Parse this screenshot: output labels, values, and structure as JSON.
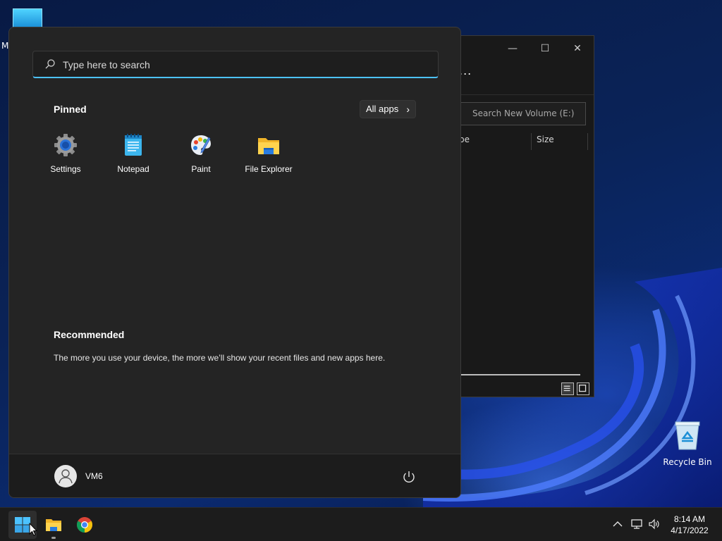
{
  "desktop": {
    "left_label": "M",
    "recycle_bin_label": "Recycle Bin"
  },
  "explorer": {
    "more_label": "...",
    "search_placeholder": "Search New Volume (E:)",
    "columns": [
      "pe",
      "Size"
    ],
    "window_buttons": {
      "minimize": "—",
      "maximize": "☐",
      "close": "✕"
    }
  },
  "start_menu": {
    "search_placeholder": "Type here to search",
    "pinned_title": "Pinned",
    "all_apps_label": "All apps",
    "all_apps_chevron": "›",
    "pinned_apps": [
      {
        "label": "Settings",
        "icon": "settings-icon"
      },
      {
        "label": "Notepad",
        "icon": "notepad-icon"
      },
      {
        "label": "Paint",
        "icon": "paint-icon"
      },
      {
        "label": "File Explorer",
        "icon": "file-explorer-icon"
      }
    ],
    "recommended_title": "Recommended",
    "recommended_text": "The more you use your device, the more we’ll show your recent files and new apps here.",
    "user_name": "VM6"
  },
  "taskbar": {
    "items": [
      {
        "name": "start-button",
        "icon": "windows-logo-icon",
        "active": true
      },
      {
        "name": "file-explorer",
        "icon": "folder-icon",
        "running": true
      },
      {
        "name": "chrome",
        "icon": "chrome-icon"
      }
    ],
    "tray": [
      "chevron-up-icon",
      "network-icon",
      "volume-icon"
    ],
    "time": "8:14 AM",
    "date": "4/17/2022"
  },
  "colors": {
    "accent": "#4cc2ff",
    "menu_bg": "#242424",
    "taskbar_bg": "#1c1c1c"
  }
}
